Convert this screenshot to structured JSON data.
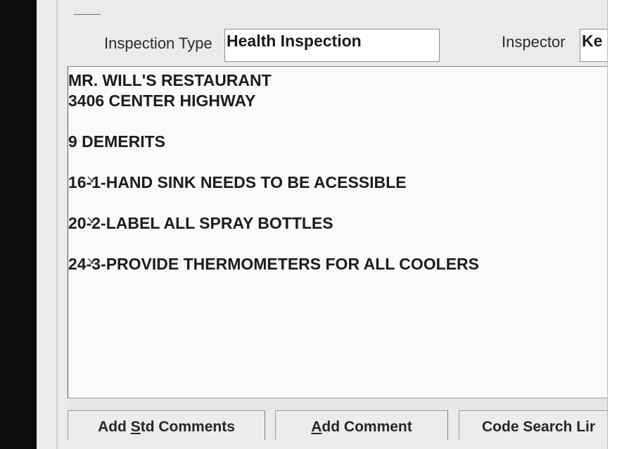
{
  "form": {
    "inspection_type_label": "Inspection Type",
    "inspection_type_value": "Health Inspection",
    "inspector_label": "Inspector",
    "inspector_value": "Ke"
  },
  "comments": {
    "lines": [
      "MR. WILL'S RESTAURANT",
      "3406 CENTER HIGHWAY",
      "9 DEMERITS",
      "16-1-HAND SINK NEEDS TO BE ACESSIBLE",
      "20-2-LABEL ALL SPRAY BOTTLES",
      "24-3-PROVIDE THERMOMETERS FOR ALL COOLERS"
    ],
    "violations": [
      {
        "code": "16",
        "text": "-1-HAND SINK NEEDS TO BE ACESSIBLE"
      },
      {
        "code": "20",
        "text": "-2-LABEL ALL SPRAY BOTTLES"
      },
      {
        "code": "24",
        "text": "-3-PROVIDE THERMOMETERS FOR ALL COOLERS"
      }
    ]
  },
  "buttons": {
    "add_std_comments": {
      "pre": "Add ",
      "accel": "S",
      "post": "td Comments"
    },
    "add_comment": {
      "pre": "",
      "accel": "A",
      "post": "dd Comment"
    },
    "code_search": {
      "label": "Code Search Lir"
    }
  }
}
